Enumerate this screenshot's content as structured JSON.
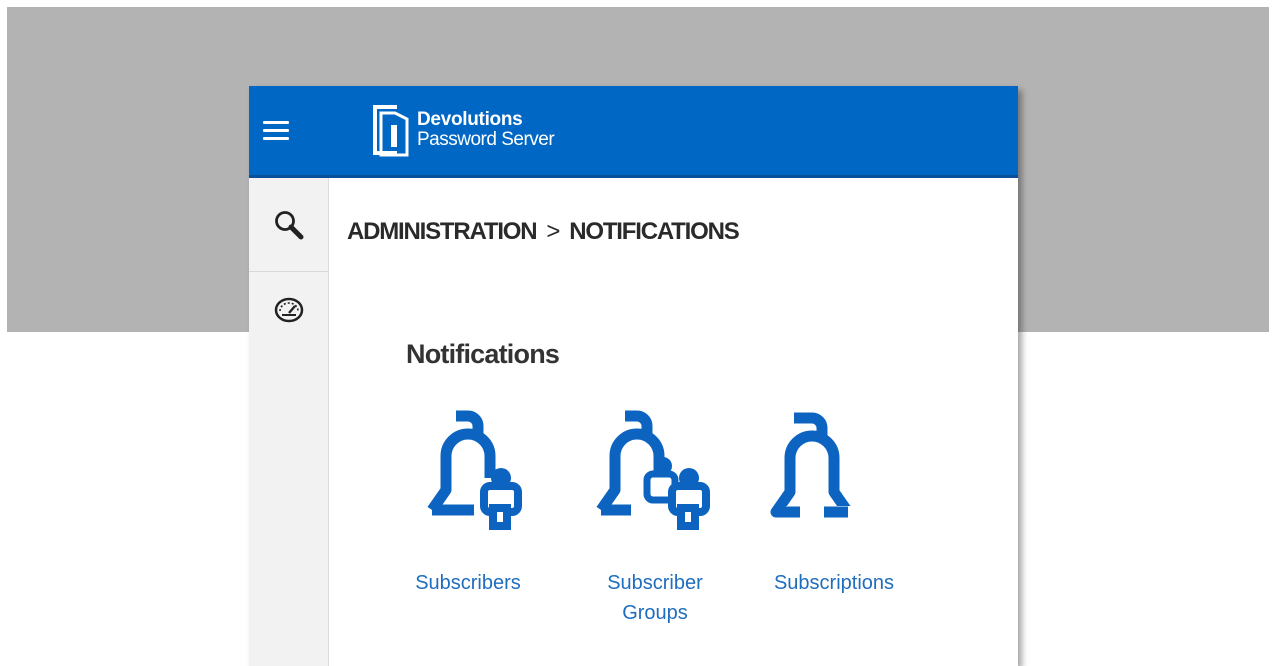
{
  "app": {
    "brand_line1": "Devolutions",
    "brand_line2": "Password Server"
  },
  "breadcrumb": {
    "items": [
      "ADMINISTRATION",
      "NOTIFICATIONS"
    ],
    "separator": ">"
  },
  "section": {
    "title": "Notifications"
  },
  "tiles": [
    {
      "label_line1": "Subscribers",
      "label_line2": "",
      "icon": "bell-user-icon"
    },
    {
      "label_line1": "Subscriber",
      "label_line2": "Groups",
      "icon": "bell-users-icon"
    },
    {
      "label_line1": "Subscriptions",
      "label_line2": "",
      "icon": "bell-icon"
    }
  ],
  "sidebar": {
    "icons": [
      "search-icon",
      "dashboard-icon",
      "favorites-icon",
      "settings-icon",
      "user-settings-icon",
      "security-icon"
    ]
  },
  "colors": {
    "topbar": "#0067c5",
    "accent": "#0c64c0",
    "link": "#1f6dbd",
    "sidebar": "#f2f2f2"
  }
}
